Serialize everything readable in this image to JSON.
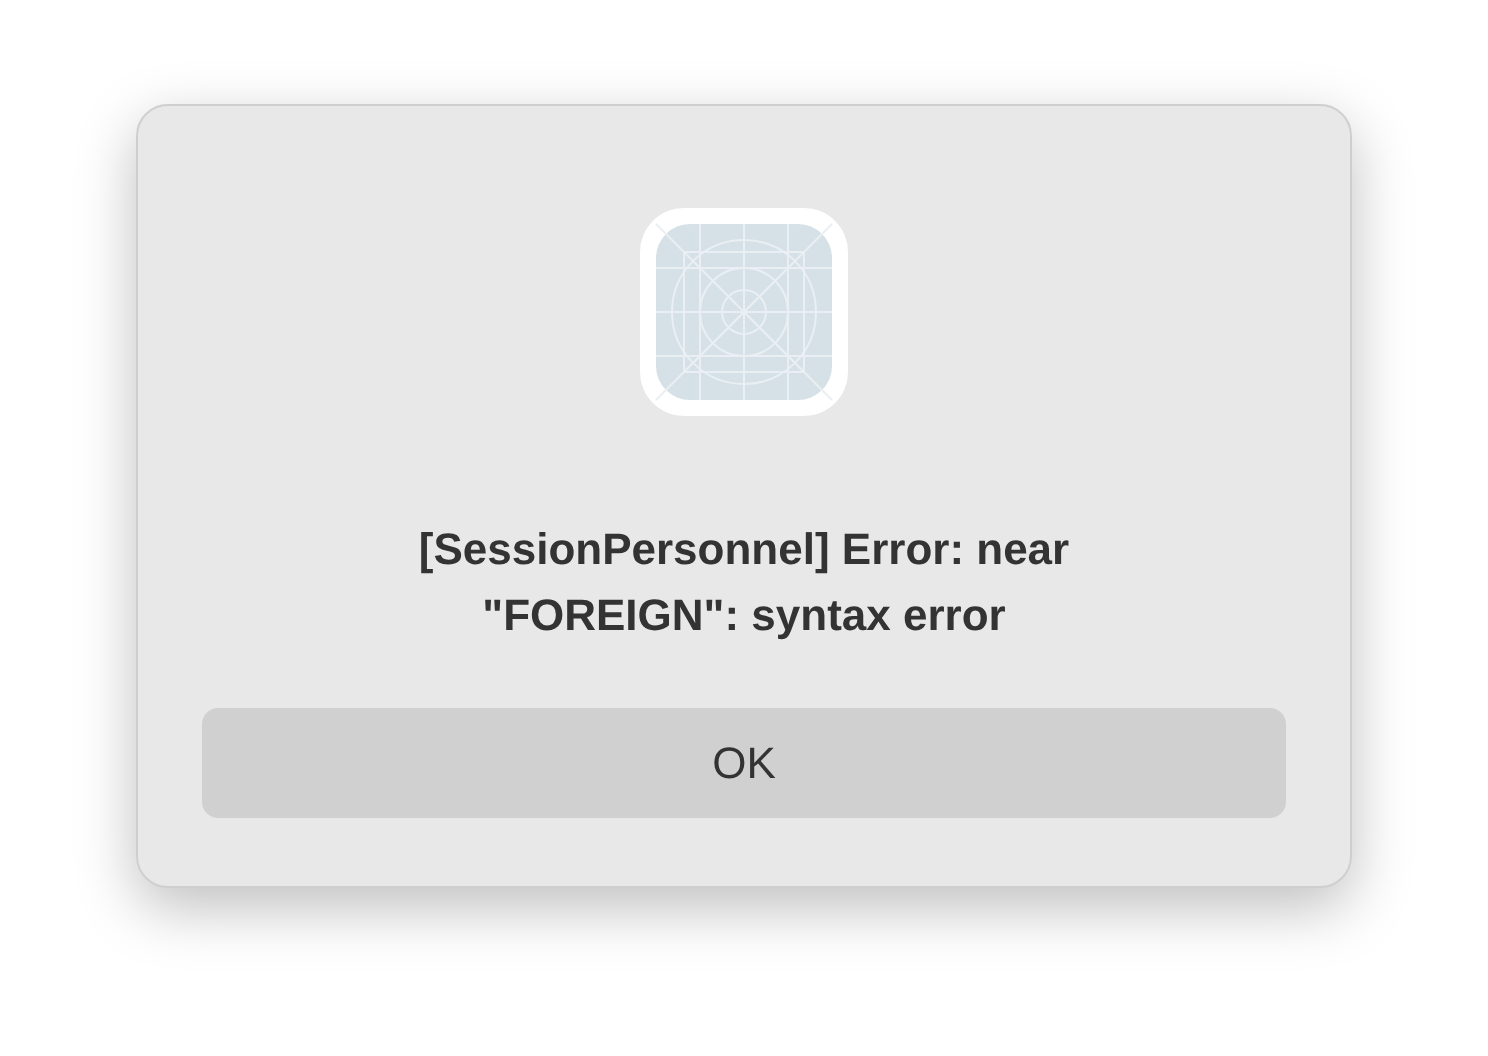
{
  "dialog": {
    "message": "[SessionPersonnel] Error: near \"FOREIGN\": syntax error",
    "buttons": [
      "OK"
    ]
  }
}
